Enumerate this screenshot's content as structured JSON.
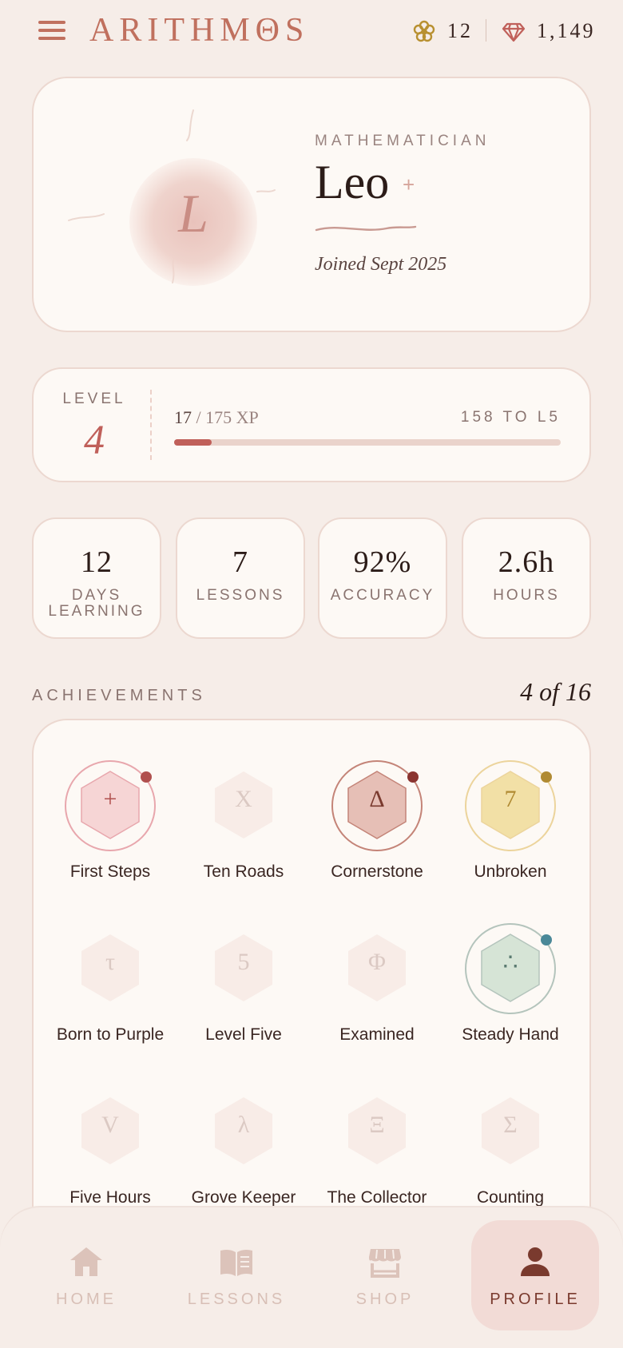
{
  "header": {
    "app_title": "ARITHMΘS",
    "petals_count": "12",
    "gems_count": "1,149",
    "icons": {
      "menu": "hamburger-menu-icon",
      "petals": "flower-icon",
      "gems": "gem-icon"
    }
  },
  "profile": {
    "avatar_letter": "L",
    "role": "MATHEMATICIAN",
    "name": "Leo",
    "sparkle": "+",
    "joined": "Joined Sept 2025"
  },
  "level": {
    "label": "LEVEL",
    "value": "4",
    "xp_current": "17",
    "xp_total": "/ 175 XP",
    "to_next": "158 TO L5",
    "progress_fraction": 0.097
  },
  "stats": [
    {
      "value": "12",
      "label_line1": "DAYS",
      "label_line2": "LEARNING"
    },
    {
      "value": "7",
      "label_line1": "LESSONS",
      "label_line2": ""
    },
    {
      "value": "92%",
      "label_line1": "ACCURACY",
      "label_line2": ""
    },
    {
      "value": "2.6h",
      "label_line1": "HOURS",
      "label_line2": ""
    }
  ],
  "achievements": {
    "title": "ACHIEVEMENTS",
    "count": "4 of 16",
    "items": [
      {
        "name": "First Steps",
        "glyph": "+",
        "unlocked": true,
        "color": "#e8a7ad",
        "fill": "#f6d5d5",
        "glyph_color": "#b0504e",
        "dot": "#b0504e"
      },
      {
        "name": "Ten Roads",
        "glyph": "X",
        "unlocked": false
      },
      {
        "name": "Cornerstone",
        "glyph": "Δ",
        "unlocked": true,
        "color": "#c48478",
        "fill": "#e6bfb6",
        "glyph_color": "#7a3a2e",
        "dot": "#8a3430"
      },
      {
        "name": "Unbroken",
        "glyph": "7",
        "unlocked": true,
        "color": "#ecd49c",
        "fill": "#f2e0a6",
        "glyph_color": "#b08a32",
        "dot": "#b08a32"
      },
      {
        "name": "Born to Purple",
        "glyph": "τ",
        "unlocked": false
      },
      {
        "name": "Level Five",
        "glyph": "5",
        "unlocked": false
      },
      {
        "name": "Examined",
        "glyph": "Φ",
        "unlocked": false
      },
      {
        "name": "Steady Hand",
        "glyph": "∴",
        "unlocked": true,
        "color": "#b4c4bc",
        "fill": "#d6e4d6",
        "glyph_color": "#5a7a70",
        "dot": "#4a8898"
      },
      {
        "name": "Five Hours",
        "glyph": "V",
        "unlocked": false
      },
      {
        "name": "Grove Keeper",
        "glyph": "λ",
        "unlocked": false
      },
      {
        "name": "The Collector",
        "glyph": "Ξ",
        "unlocked": false
      },
      {
        "name": "Counting House",
        "glyph": "Σ",
        "unlocked": false
      }
    ]
  },
  "nav": [
    {
      "label": "HOME",
      "icon": "home-icon",
      "active": false
    },
    {
      "label": "LESSONS",
      "icon": "book-icon",
      "active": false
    },
    {
      "label": "SHOP",
      "icon": "storefront-icon",
      "active": false
    },
    {
      "label": "PROFILE",
      "icon": "person-icon",
      "active": true
    }
  ],
  "colors": {
    "background": "#f6ede8",
    "card": "#fdf9f5",
    "accent": "#c0605a",
    "brand": "#c0705e"
  }
}
